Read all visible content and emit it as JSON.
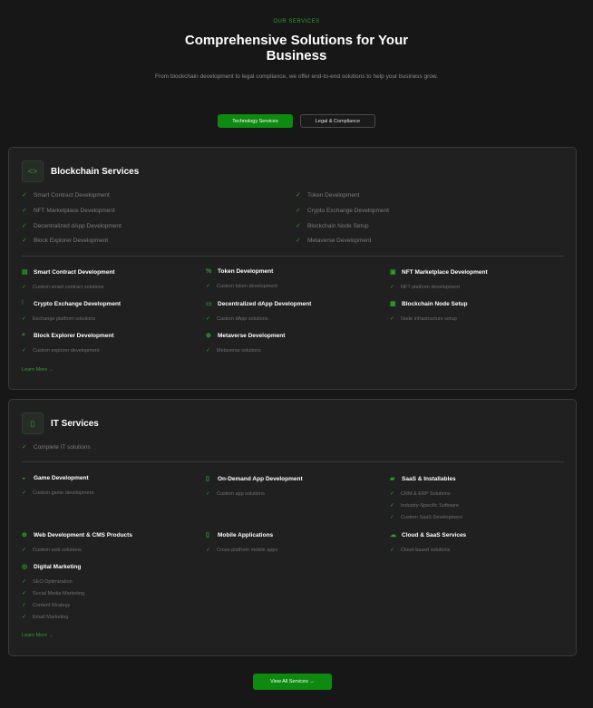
{
  "header": {
    "eyebrow": "OUR SERVICES",
    "title": "Comprehensive Solutions for Your Business",
    "subtitle": "From blockchain development to legal compliance, we offer end-to-end solutions to help your business grow."
  },
  "tabs": [
    {
      "label": "Technology Services",
      "active": true
    },
    {
      "label": "Legal & Compliance",
      "active": false
    }
  ],
  "blockchain": {
    "title": "Blockchain Services",
    "icon": "code-brackets-icon",
    "features": [
      "Smart Contract Development",
      "Token Development",
      "NFT Marketplace Development",
      "Crypto Exchange Development",
      "Decentralized dApp Development",
      "Blockchain Node Setup",
      "Block Explorer Development",
      "Metaverse Development"
    ],
    "services": [
      {
        "title": "Smart Contract Development",
        "icon": "document-icon",
        "subs": [
          "Custom smart contract solutions"
        ]
      },
      {
        "title": "Token Development",
        "icon": "coins-icon",
        "subs": [
          "Custom token development"
        ]
      },
      {
        "title": "NFT Marketplace Development",
        "icon": "image-icon",
        "subs": [
          "NFT platform development"
        ]
      },
      {
        "title": "Crypto Exchange Development",
        "icon": "chart-icon",
        "subs": [
          "Exchange platform solutions"
        ]
      },
      {
        "title": "Decentralized dApp Development",
        "icon": "window-icon",
        "subs": [
          "Custom dApp solutions"
        ]
      },
      {
        "title": "Blockchain Node Setup",
        "icon": "server-icon",
        "subs": [
          "Node infrastructure setup"
        ]
      },
      {
        "title": "Block Explorer Development",
        "icon": "search-icon",
        "subs": [
          "Custom explorer development"
        ]
      },
      {
        "title": "Metaverse Development",
        "icon": "globe-icon",
        "subs": [
          "Metaverse solutions"
        ]
      }
    ],
    "learn_more": "Learn More →"
  },
  "it": {
    "title": "IT Services",
    "icon": "mobile-icon",
    "features": [
      "Complete IT solutions"
    ],
    "services": [
      {
        "title": "Game Development",
        "icon": "gamepad-icon",
        "subs": [
          "Custom game development"
        ]
      },
      {
        "title": "On-Demand App Development",
        "icon": "mobile-icon",
        "subs": [
          "Custom app solutions"
        ]
      },
      {
        "title": "SaaS & Installables",
        "icon": "layers-icon",
        "subs": [
          "CRM & ERP Solutions",
          "Industry-Specific Software",
          "Custom SaaS Development"
        ]
      },
      {
        "title": "Web Development & CMS Products",
        "icon": "globe-icon",
        "subs": [
          "Custom web solutions"
        ]
      },
      {
        "title": "Mobile Applications",
        "icon": "mobile-icon",
        "subs": [
          "Cross-platform mobile apps"
        ]
      },
      {
        "title": "Cloud & SaaS Services",
        "icon": "cloud-icon",
        "subs": [
          "Cloud-based solutions"
        ]
      },
      {
        "title": "Digital Marketing",
        "icon": "target-icon",
        "subs": [
          "SEO Optimization",
          "Social Media Marketing",
          "Content Strategy",
          "Email Marketing"
        ]
      }
    ],
    "learn_more": "Learn More →"
  },
  "cta": {
    "label": "View All Services →"
  },
  "colors": {
    "accent": "#0f8a10",
    "accent_text": "#2e9e2e",
    "background": "#171717",
    "card": "#202021"
  }
}
